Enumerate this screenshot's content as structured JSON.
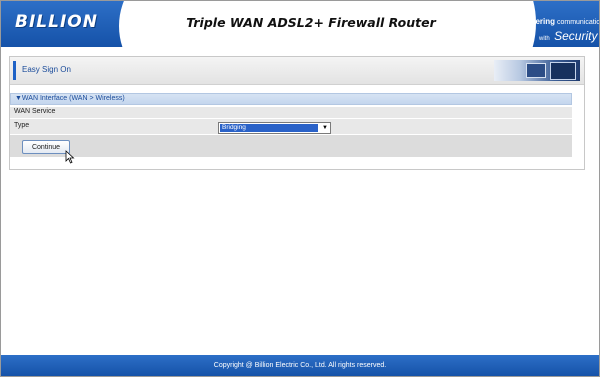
{
  "header": {
    "logo": "BILLION",
    "title": "Triple WAN ADSL2+ Firewall Router",
    "tagline_prefix": "Powering",
    "tagline_suffix": "communications",
    "tagline_with": "with",
    "tagline_security": "Security"
  },
  "panel": {
    "title": "Easy Sign On",
    "section_heading": "▼WAN Interface   (WAN > Wireless)",
    "service_row_label": "WAN Service",
    "type_label": "Type",
    "type_select_value": "Bridging",
    "continue_button": "Continue"
  },
  "footer": {
    "copyright": "Copyright @ Billion Electric Co., Ltd. All rights reserved."
  },
  "colors": {
    "brand_blue": "#1552a8",
    "selection_blue": "#2a62c8",
    "section_text": "#1a4b9a"
  },
  "icons": {
    "dropdown": "chevron-down-icon",
    "pointer": "mouse-cursor-icon"
  }
}
